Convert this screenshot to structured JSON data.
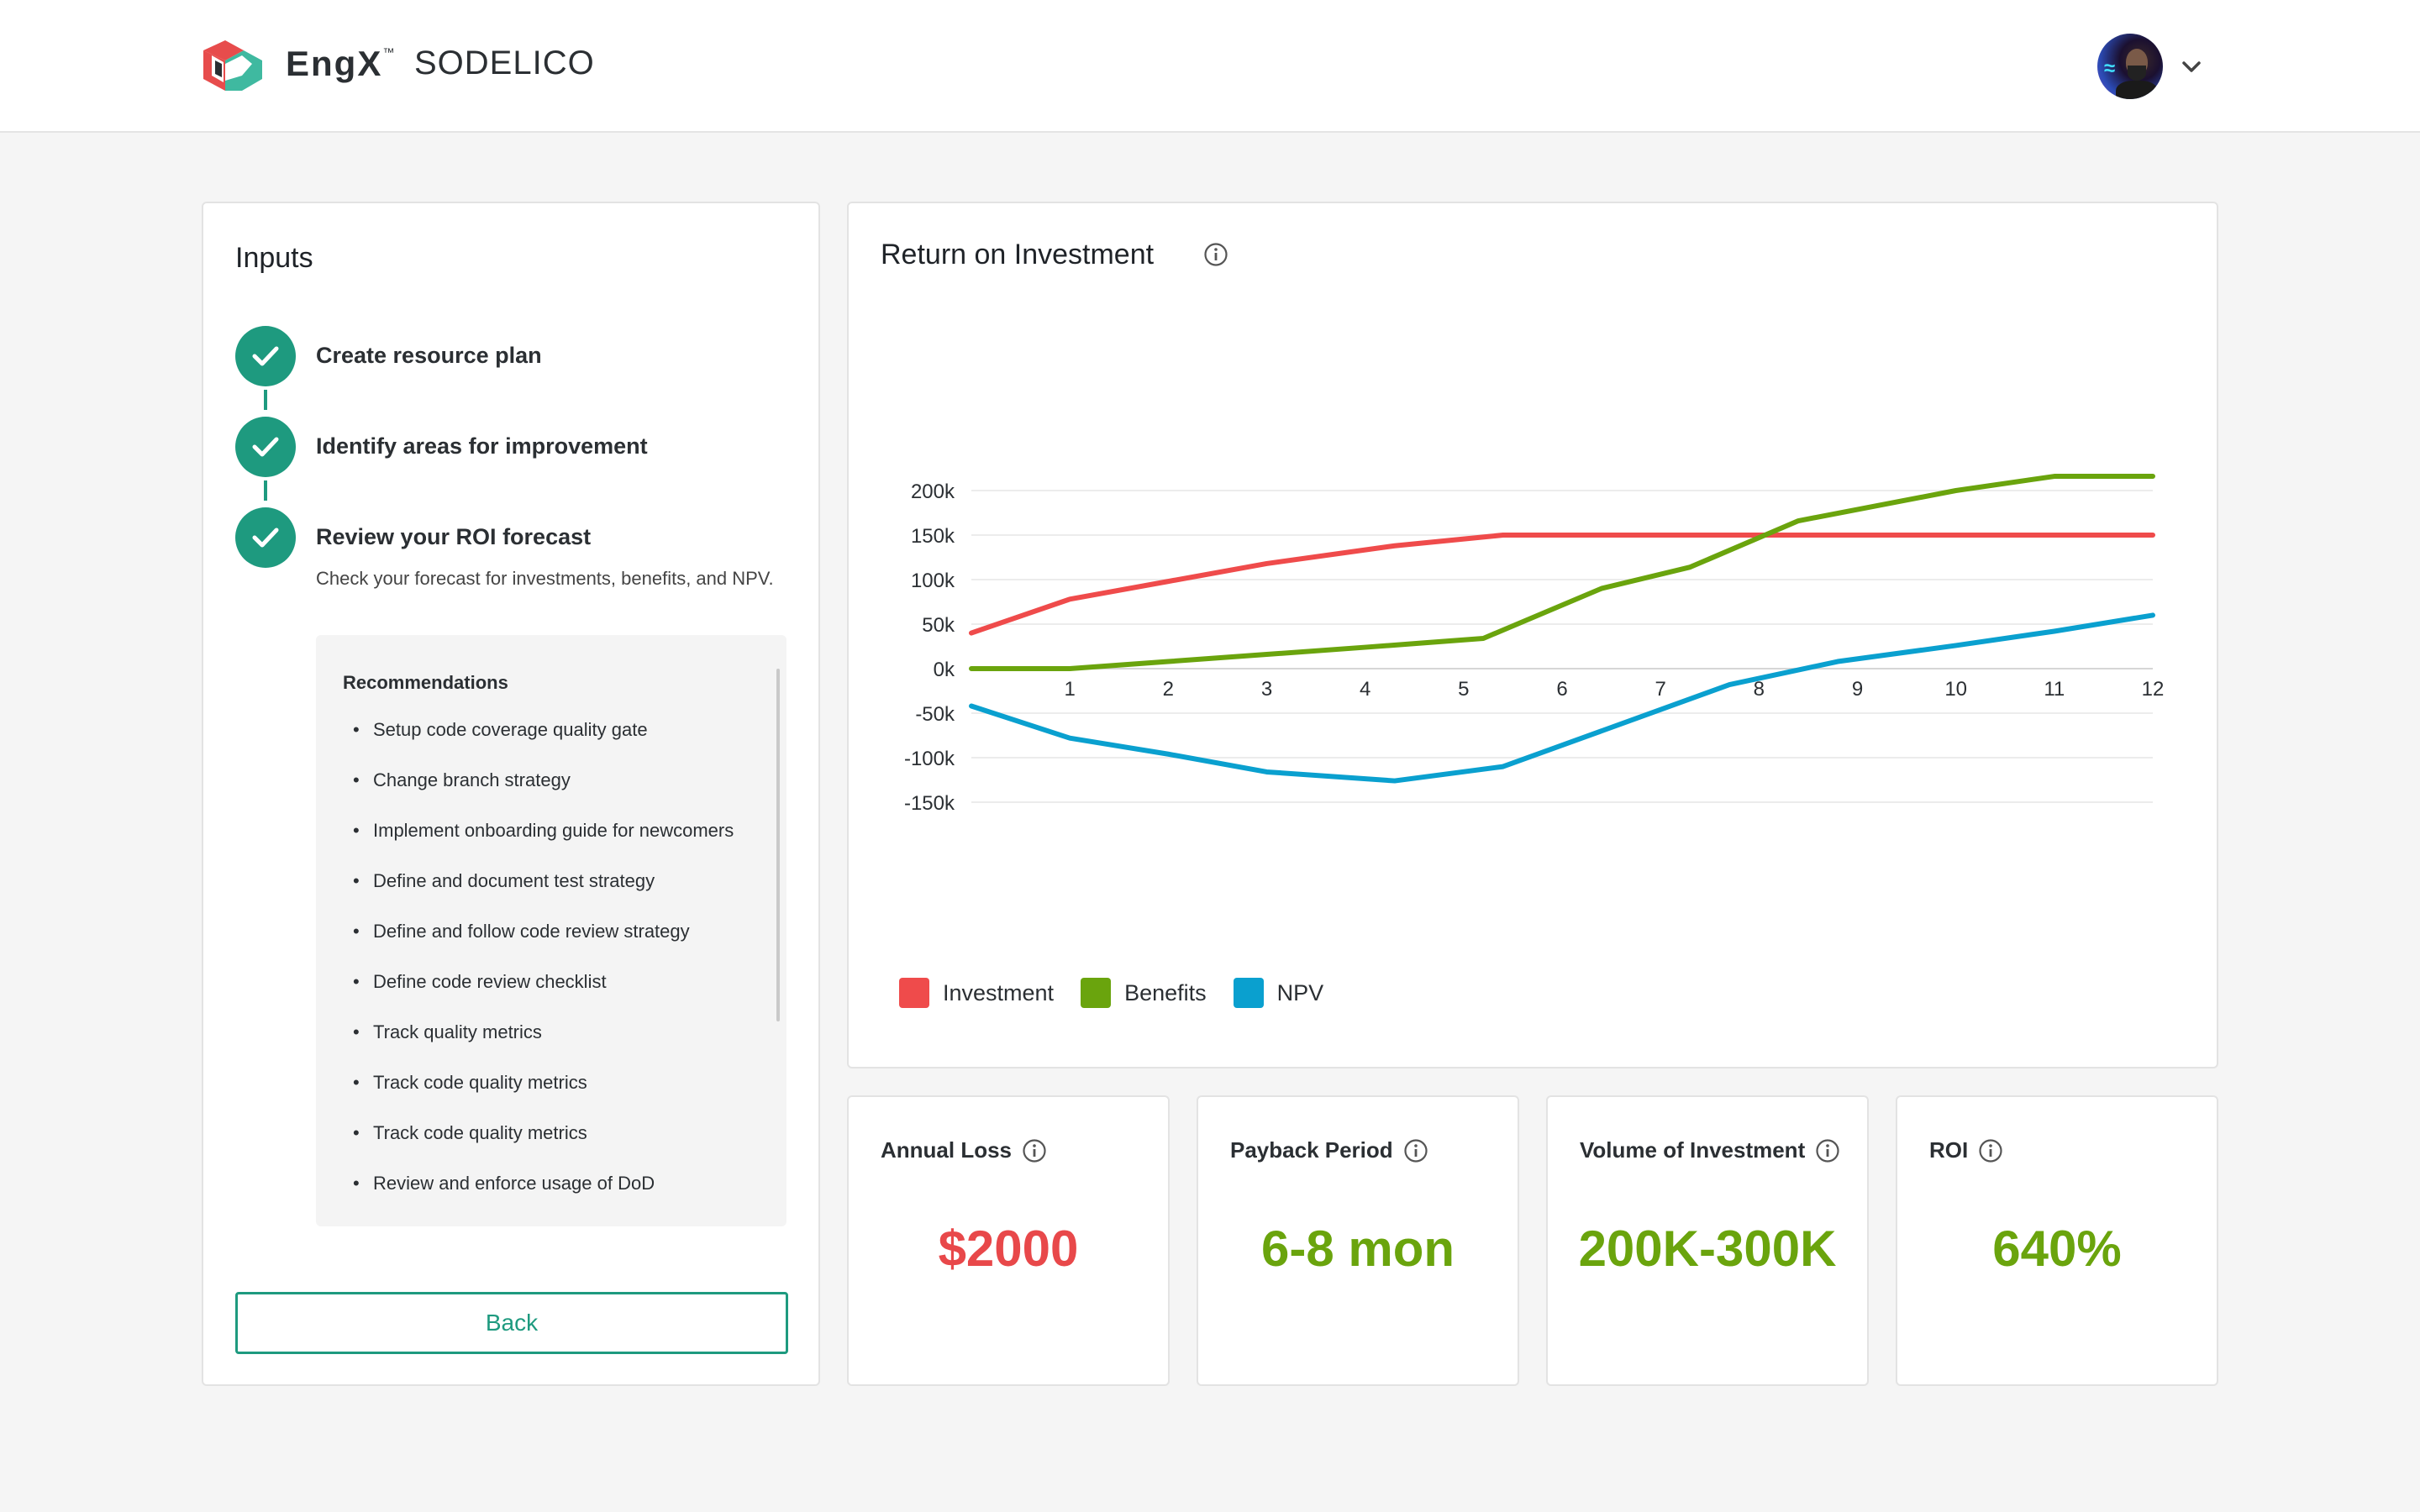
{
  "header": {
    "brand": "EngX",
    "trademark": "™",
    "company": "SODELICO",
    "user_menu_icon": "chevron-down-icon"
  },
  "inputs": {
    "title": "Inputs",
    "steps": [
      {
        "label": "Create resource plan",
        "status": "completed"
      },
      {
        "label": "Identify areas for improvement",
        "status": "completed"
      },
      {
        "label": "Review your ROI forecast",
        "status": "completed",
        "description": "Check your forecast for investments, benefits, and NPV."
      }
    ],
    "recommendations_title": "Recommendations",
    "recommendations": [
      "Setup code coverage quality gate",
      "Change branch strategy",
      "Implement onboarding guide for newcomers",
      "Define and document test strategy",
      "Define and follow code review strategy",
      "Define code review checklist",
      "Track quality metrics",
      "Track code quality metrics",
      "Track code quality metrics",
      "Review and enforce usage of DoD"
    ],
    "back_label": "Back"
  },
  "roi": {
    "title": "Return on Investment"
  },
  "chart_data": {
    "type": "line",
    "title": "Return on Investment",
    "x": [
      0,
      1,
      2,
      3,
      4,
      5,
      6,
      7,
      8,
      9,
      10,
      11,
      12
    ],
    "xticks": [
      "1",
      "2",
      "3",
      "4",
      "5",
      "6",
      "7",
      "8",
      "9",
      "10",
      "11",
      "12"
    ],
    "yticks": [
      "200k",
      "150k",
      "100k",
      "50k",
      "0k",
      "-50k",
      "-100k",
      "-150k"
    ],
    "ytick_values": [
      200,
      150,
      100,
      50,
      0,
      -50,
      -100,
      -150
    ],
    "ylim": [
      -150,
      200
    ],
    "xlim": [
      0,
      12
    ],
    "grid": true,
    "legend_position": "bottom-left",
    "series": [
      {
        "name": "Investment",
        "color": "#ef4b4b",
        "x": [
          0,
          1,
          2,
          3,
          4.3,
          5.4,
          12
        ],
        "values": [
          40,
          78,
          98,
          118,
          138,
          150,
          150
        ]
      },
      {
        "name": "Benefits",
        "color": "#6aa40d",
        "x": [
          0,
          1,
          2,
          3,
          4,
          5.2,
          6.4,
          7.3,
          8.4,
          10,
          11,
          12
        ],
        "values": [
          0,
          0,
          8,
          16,
          24,
          34,
          90,
          114,
          166,
          200,
          216,
          216
        ]
      },
      {
        "name": "NPV",
        "color": "#0aa0cf",
        "x": [
          0,
          1,
          2,
          3,
          4.3,
          5.4,
          6.4,
          7.7,
          8.8,
          10,
          11,
          12
        ],
        "values": [
          -42,
          -78,
          -96,
          -116,
          -126,
          -110,
          -70,
          -18,
          8,
          26,
          42,
          60
        ]
      }
    ]
  },
  "metrics": [
    {
      "title": "Annual Loss",
      "value": "$2000",
      "color": "#e8484a"
    },
    {
      "title": "Payback Period",
      "value": "6-8 mon",
      "color": "#6aa40d"
    },
    {
      "title": "Volume of Investment",
      "value": "200K-300K",
      "color": "#6aa40d"
    },
    {
      "title": "ROI",
      "value": "640%",
      "color": "#6aa40d"
    }
  ],
  "colors": {
    "accent": "#1e9a7f",
    "background": "#f5f5f5"
  }
}
